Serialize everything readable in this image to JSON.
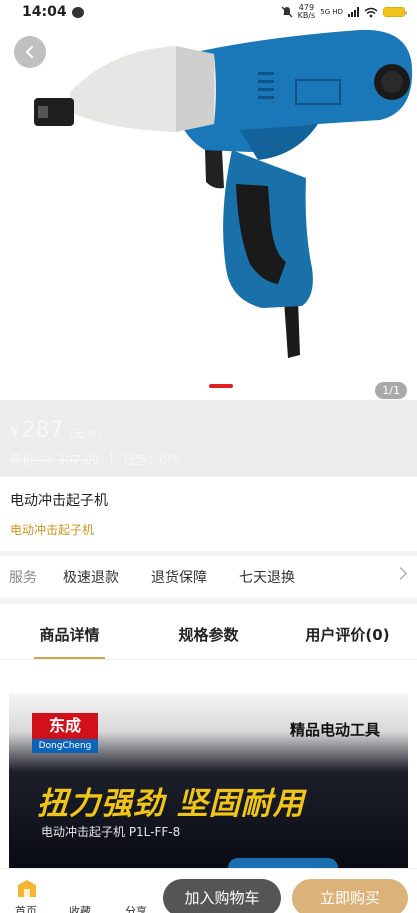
{
  "status_bar": {
    "time": "14:04",
    "speed_value": "479",
    "speed_unit": "KB/s",
    "network": "5G HD"
  },
  "gallery": {
    "page_count": "1/1",
    "back_icon": "chevron-left-icon"
  },
  "price": {
    "symbol": "¥",
    "value": "287",
    "tag": "(元/台)",
    "original": "原价：¥ 307.00",
    "divider": "|",
    "sold": "已售：0件"
  },
  "product": {
    "title": "电动冲击起子机",
    "subtitle": "电动冲击起子机"
  },
  "service": {
    "label": "服务",
    "items": [
      "极速退款",
      "退货保障",
      "七天退换"
    ]
  },
  "tabs": [
    {
      "label": "商品详情",
      "active": true
    },
    {
      "label": "规格参数",
      "active": false
    },
    {
      "label": "用户评价(0)",
      "active": false
    }
  ],
  "banner": {
    "brand_cn": "东成",
    "brand_en": "DongCheng",
    "tag": "精品电动工具",
    "headline": "扭力强劲 坚固耐用",
    "model": "电动冲击起子机 P1L-FF-8"
  },
  "bottom_bar": {
    "home": "首页",
    "favorite": "收藏",
    "share": "分享",
    "add_cart": "加入购物车",
    "buy_now": "立即购买"
  },
  "colors": {
    "accent_gold": "#d4a347",
    "buy_button": "#dab27a",
    "cart_button": "#555555",
    "pager_active": "#e02020",
    "subtitle": "#c8961e"
  }
}
